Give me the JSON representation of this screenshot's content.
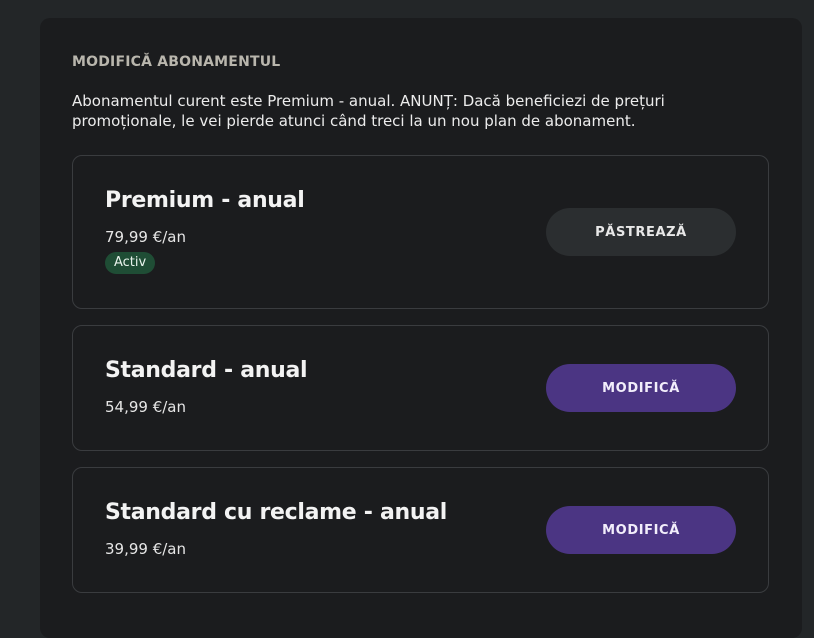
{
  "section": {
    "title": "MODIFICĂ ABONAMENTUL",
    "notice": "Abonamentul curent este Premium - anual. ANUNȚ: Dacă beneficiezi de prețuri promoționale, le vei pierde atunci când treci la un nou plan de abonament."
  },
  "plans": [
    {
      "name": "Premium - anual",
      "price": "79,99 €/an",
      "badge": "Activ",
      "button_label": "PĂSTREAZĂ"
    },
    {
      "name": "Standard - anual",
      "price": "54,99 €/an",
      "button_label": "MODIFICĂ"
    },
    {
      "name": "Standard cu reclame - anual",
      "price": "39,99 €/an",
      "button_label": "MODIFICĂ"
    }
  ],
  "colors": {
    "background": "#232628",
    "panel": "#1b1c1e",
    "card_border": "#3a3c3f",
    "active_badge": "#1f4d35",
    "keep_button": "#2b2e30",
    "change_button": "#4b3583"
  }
}
